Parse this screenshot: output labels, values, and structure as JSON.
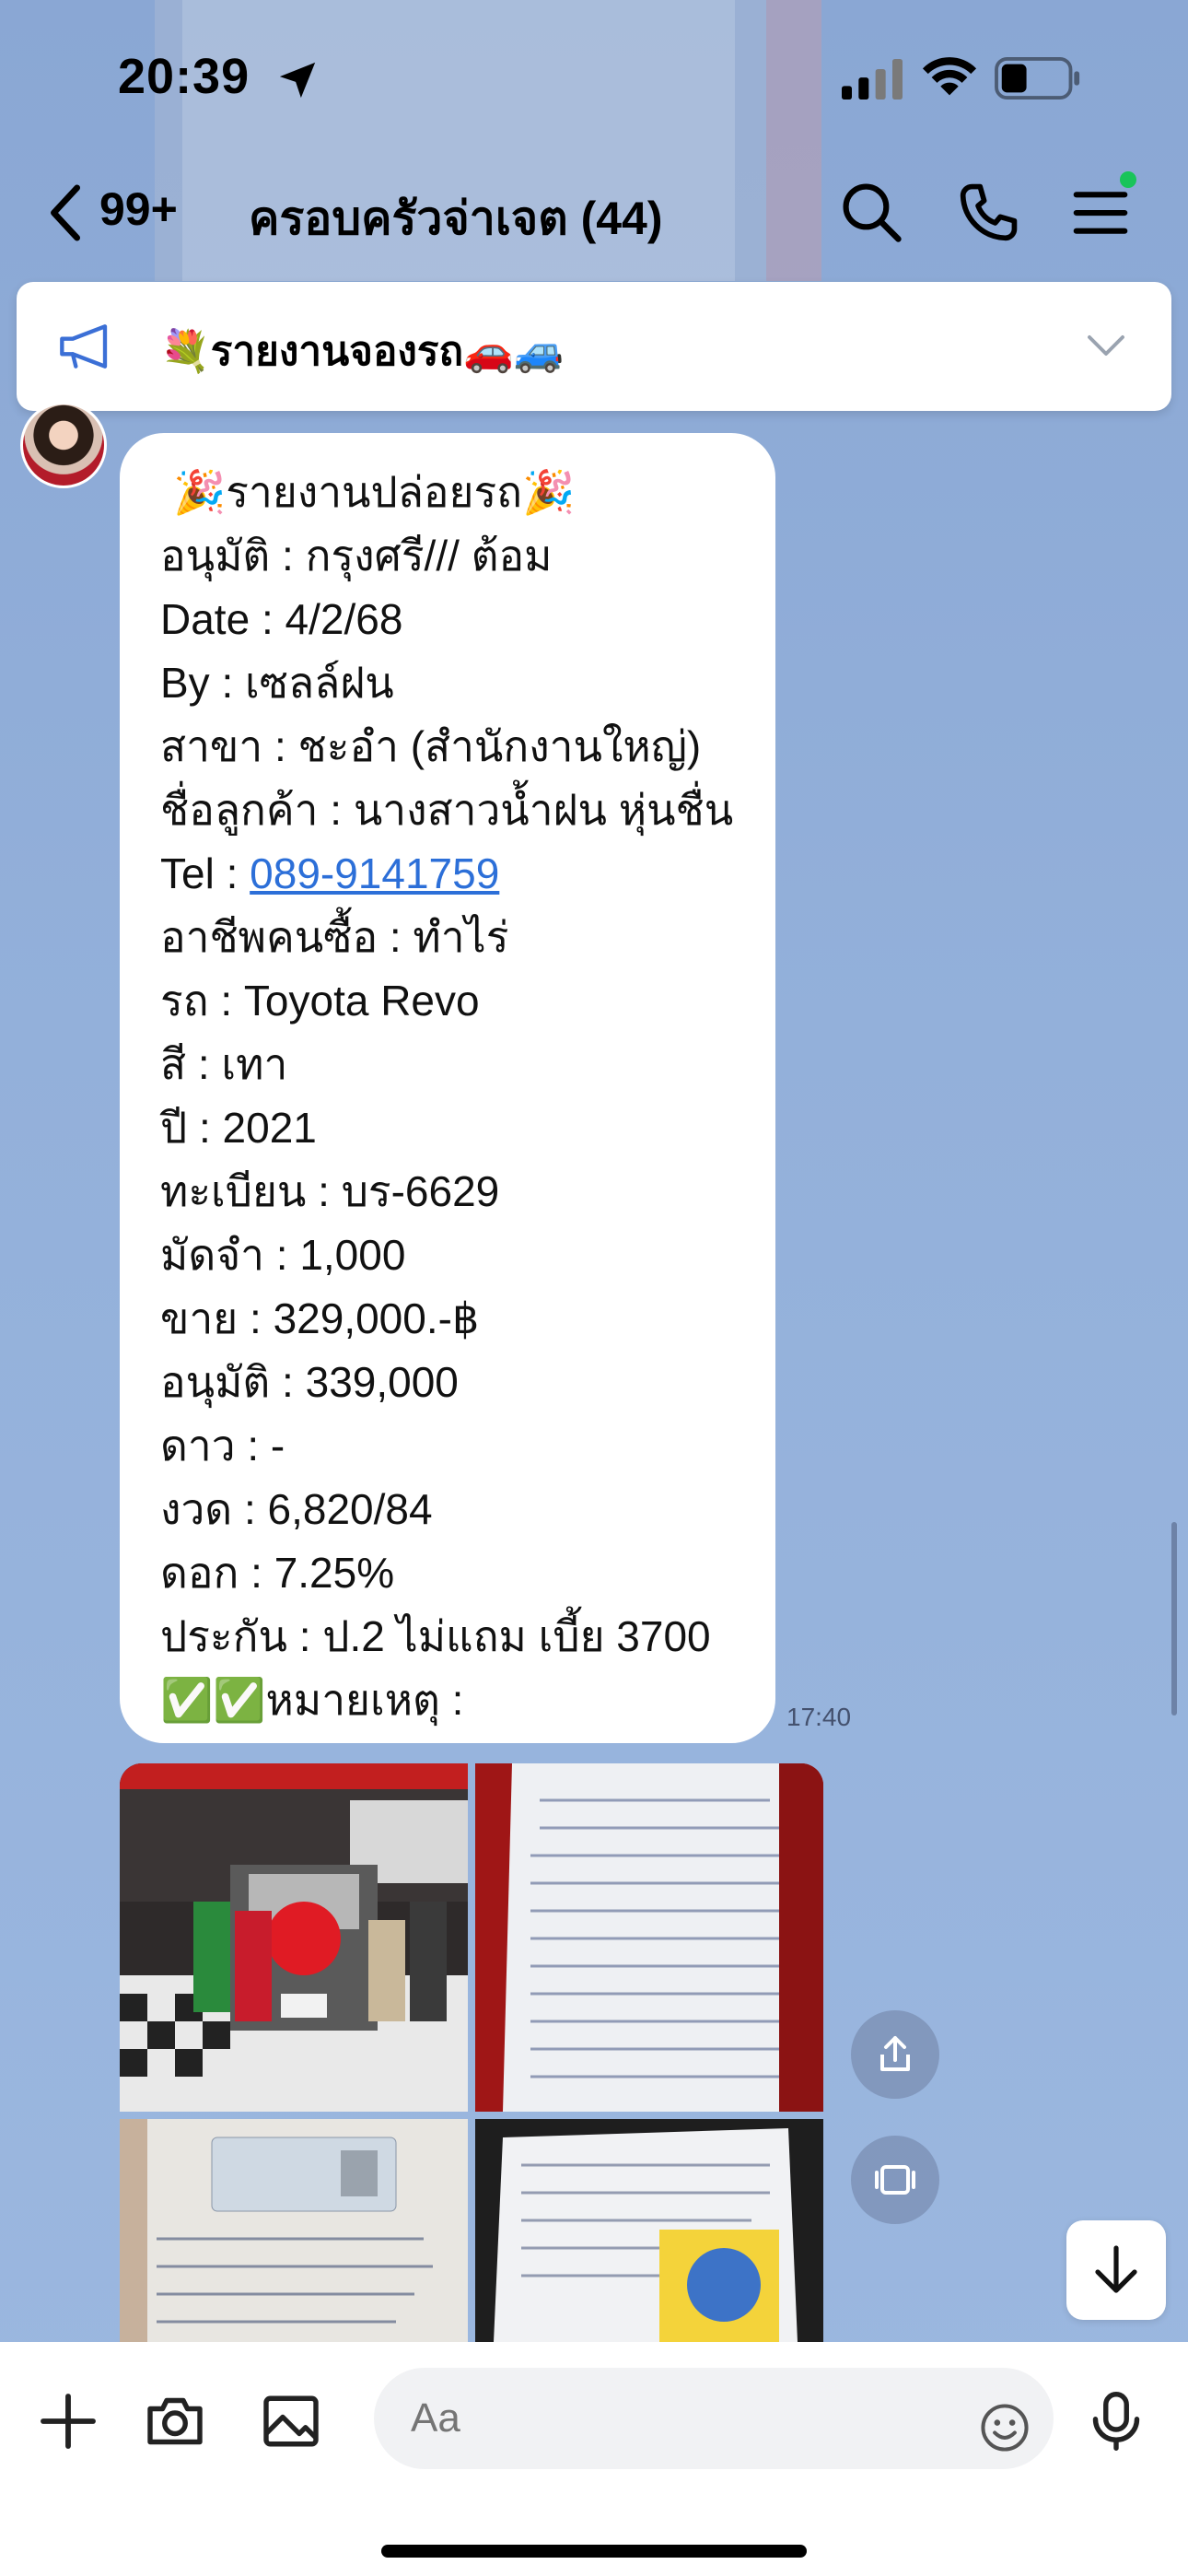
{
  "status_bar": {
    "time": "20:39"
  },
  "header": {
    "unread_count": "99+",
    "title": "ครอบครัวจ่าเจต (44)"
  },
  "announcement": {
    "text": "💐รายงานจองรถ🚗🚙"
  },
  "message": {
    "sender": "",
    "time": "17:40",
    "lines": {
      "title": "🎉รายงานปล่อยรถ🎉",
      "approve_by": "อนุมัติ : กรุงศรี/// ต้อม",
      "date": "Date : 4/2/68",
      "by": "By : เซลล์ฝน",
      "branch": "สาขา : ชะอำ (สำนักงานใหญ่)",
      "customer": "ชื่อลูกค้า : นางสาวน้ำฝน  หุ่นชื่น",
      "tel_label": "Tel : ",
      "tel_value": "089-9141759",
      "occupation": "อาชีพคนซื้อ : ทำไร่",
      "car": "รถ : Toyota Revo",
      "color": "สี : เทา",
      "year": "ปี : 2021",
      "plate": "ทะเบียน : บร-6629",
      "deposit": "มัดจำ : 1,000",
      "price": "ขาย : 329,000.-฿",
      "approved_amount": "อนุมัติ : 339,000",
      "down": "ดาว : -",
      "installment": "งวด : 6,820/84",
      "interest": "ดอก : 7.25%",
      "insurance": "ประกัน : ป.2 ไม่แถม เบี้ย 3700",
      "note": "✅✅หมายเหตุ :"
    }
  },
  "composer": {
    "placeholder": "Aa"
  },
  "colors": {
    "chat_bg": "#8eaad6",
    "link": "#2c6fd8",
    "online_dot": "#19c45a"
  }
}
